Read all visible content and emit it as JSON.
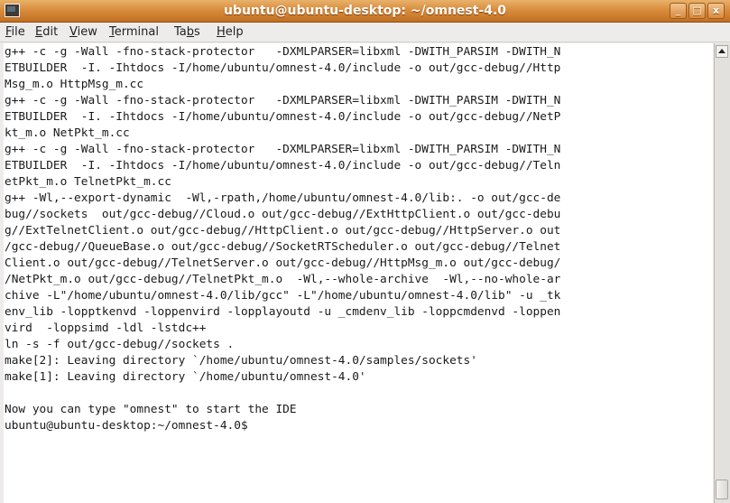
{
  "window": {
    "title": "ubuntu@ubuntu-desktop: ~/omnest-4.0",
    "minimize_symbol": "_",
    "maximize_symbol": "□",
    "close_symbol": "x"
  },
  "menu": {
    "file": {
      "mnemonic": "F",
      "rest": "ile"
    },
    "edit": {
      "mnemonic": "E",
      "rest": "dit"
    },
    "view": {
      "mnemonic": "V",
      "rest": "iew"
    },
    "terminal": {
      "mnemonic": "T",
      "rest": "erminal"
    },
    "tabs": {
      "pre": "Ta",
      "mnemonic": "b",
      "rest": "s"
    },
    "help": {
      "mnemonic": "H",
      "rest": "elp"
    }
  },
  "terminal": {
    "output": "g++ -c -g -Wall -fno-stack-protector   -DXMLPARSER=libxml -DWITH_PARSIM -DWITH_N\nETBUILDER  -I. -Ihtdocs -I/home/ubuntu/omnest-4.0/include -o out/gcc-debug//Http\nMsg_m.o HttpMsg_m.cc\ng++ -c -g -Wall -fno-stack-protector   -DXMLPARSER=libxml -DWITH_PARSIM -DWITH_N\nETBUILDER  -I. -Ihtdocs -I/home/ubuntu/omnest-4.0/include -o out/gcc-debug//NetP\nkt_m.o NetPkt_m.cc\ng++ -c -g -Wall -fno-stack-protector   -DXMLPARSER=libxml -DWITH_PARSIM -DWITH_N\nETBUILDER  -I. -Ihtdocs -I/home/ubuntu/omnest-4.0/include -o out/gcc-debug//Teln\netPkt_m.o TelnetPkt_m.cc\ng++ -Wl,--export-dynamic  -Wl,-rpath,/home/ubuntu/omnest-4.0/lib:. -o out/gcc-de\nbug//sockets  out/gcc-debug//Cloud.o out/gcc-debug//ExtHttpClient.o out/gcc-debu\ng//ExtTelnetClient.o out/gcc-debug//HttpClient.o out/gcc-debug//HttpServer.o out\n/gcc-debug//QueueBase.o out/gcc-debug//SocketRTScheduler.o out/gcc-debug//Telnet\nClient.o out/gcc-debug//TelnetServer.o out/gcc-debug//HttpMsg_m.o out/gcc-debug/\n/NetPkt_m.o out/gcc-debug//TelnetPkt_m.o  -Wl,--whole-archive  -Wl,--no-whole-ar\nchive -L\"/home/ubuntu/omnest-4.0/lib/gcc\" -L\"/home/ubuntu/omnest-4.0/lib\" -u _tk\nenv_lib -lopptkenvd -loppenvird -lopplayoutd -u _cmdenv_lib -loppcmdenvd -loppen\nvird  -loppsimd -ldl -lstdc++\nln -s -f out/gcc-debug//sockets .\nmake[2]: Leaving directory `/home/ubuntu/omnest-4.0/samples/sockets'\nmake[1]: Leaving directory `/home/ubuntu/omnest-4.0'\n\nNow you can type \"omnest\" to start the IDE\nubuntu@ubuntu-desktop:~/omnest-4.0$"
  }
}
